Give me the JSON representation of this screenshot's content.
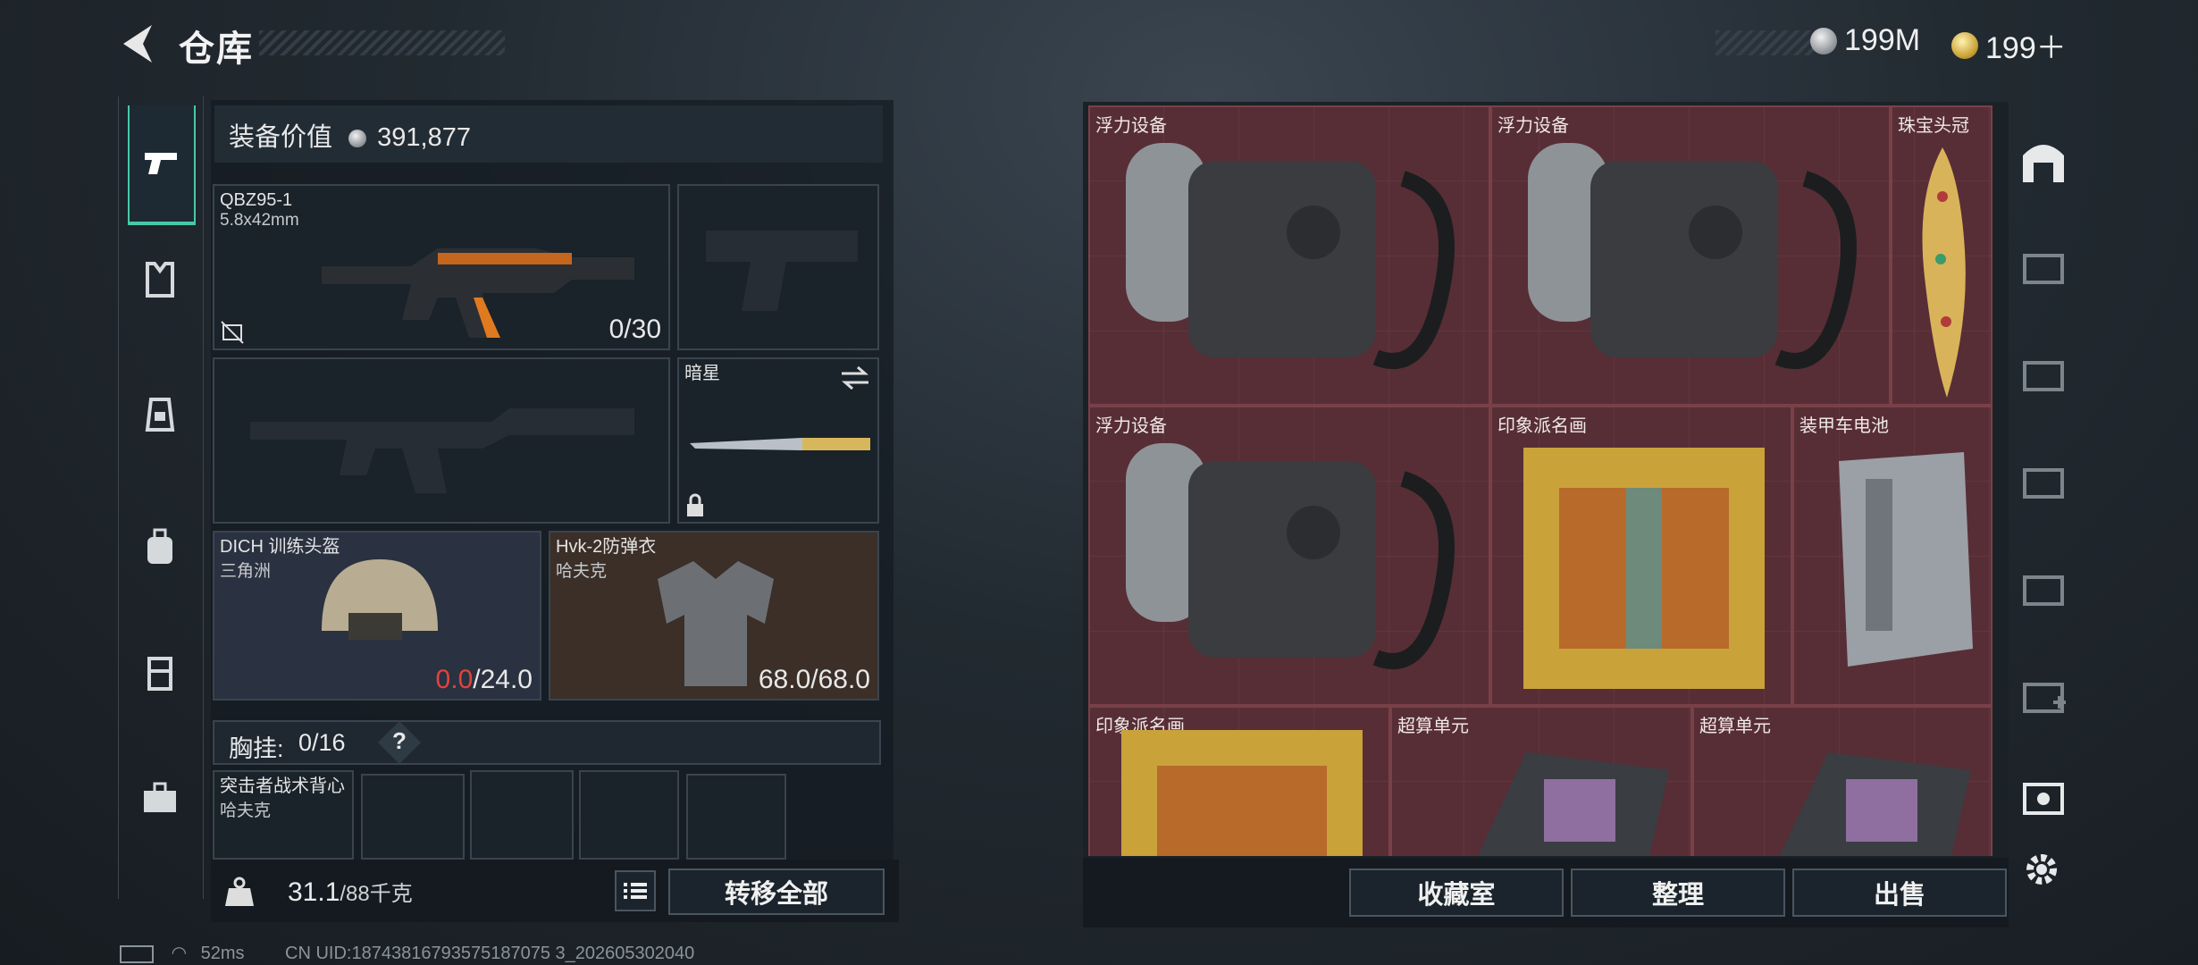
{
  "header": {
    "title": "仓库",
    "currency_silver": "199M",
    "currency_gold": "199＋"
  },
  "nav": {
    "icons": [
      "pistol-icon",
      "armor-vest-icon",
      "chest-rig-icon",
      "backpack-icon",
      "container-icon",
      "case-icon"
    ]
  },
  "equipment": {
    "value_label": "装备价值",
    "value": "391,877",
    "primary": {
      "name": "QBZ95-1",
      "ammo": "5.8x42mm",
      "count": "0/30"
    },
    "melee": {
      "name": "暗星"
    },
    "helmet": {
      "name": "DICH 训练头盔",
      "faction": "三角洲",
      "current": "0.0",
      "max": "/24.0"
    },
    "armor": {
      "name": "Hvk-2防弹衣",
      "faction": "哈夫克",
      "durability": "68.0/68.0"
    },
    "chest": {
      "label": "胸挂:",
      "count": "0/16",
      "help": "?"
    },
    "vest": {
      "name": "突击者战术背心",
      "faction": "哈夫克"
    }
  },
  "weight": {
    "current": "31.1",
    "max": "/88千克"
  },
  "buttons": {
    "transfer_all": "转移全部",
    "collection": "收藏室",
    "organize": "整理",
    "sell": "出售"
  },
  "grid_items": [
    {
      "label": "浮力设备"
    },
    {
      "label": "浮力设备"
    },
    {
      "label": "珠宝头冠"
    },
    {
      "label": "浮力设备"
    },
    {
      "label": "印象派名画"
    },
    {
      "label": "装甲车电池"
    },
    {
      "label": "印象派名画"
    },
    {
      "label": "超算单元"
    },
    {
      "label": "超算单元"
    }
  ],
  "status": {
    "ping": "52ms",
    "uid": "CN UID:18743816793575187075 3_202605302040"
  }
}
